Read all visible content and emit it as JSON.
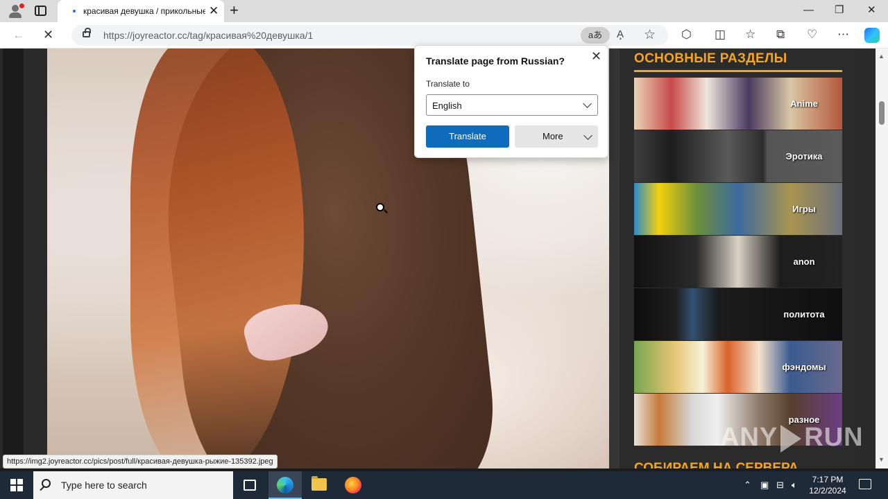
{
  "browser": {
    "tab_title": "красивая девушка / прикольные",
    "new_tab": "+",
    "tab_close": "✕",
    "url": "https://joyreactor.cc/tag/красивая%20девушка/1",
    "translate_icon": "aあ",
    "read_aloud": "A̧",
    "window_controls": {
      "minimize": "—",
      "restore": "❐",
      "close": "✕"
    }
  },
  "translate_popup": {
    "title": "Translate page from Russian?",
    "label": "Translate to",
    "selected_language": "English",
    "translate_button": "Translate",
    "more_button": "More"
  },
  "sidebar": {
    "section_title": "ОСНОВНЫЕ РАЗДЕЛЫ",
    "categories": [
      "Anime",
      "Эротика",
      "Игры",
      "anon",
      "политота",
      "фэндомы",
      "разное"
    ],
    "next_section_title": "СОБИРАЕМ НА СЕРВЕРА"
  },
  "status_link": "https://img2.joyreactor.cc/pics/post/full/красивая-девушка-рыжие-135392.jpeg",
  "watermark": {
    "left": "ANY",
    "right": "RUN"
  },
  "taskbar": {
    "search_placeholder": "Type here to search",
    "time": "7:17 PM",
    "date": "12/2/2024"
  },
  "colors": {
    "accent_orange": "#f7a51b",
    "translate_blue": "#0f6cbd",
    "taskbar_bg": "#1f2a38"
  }
}
